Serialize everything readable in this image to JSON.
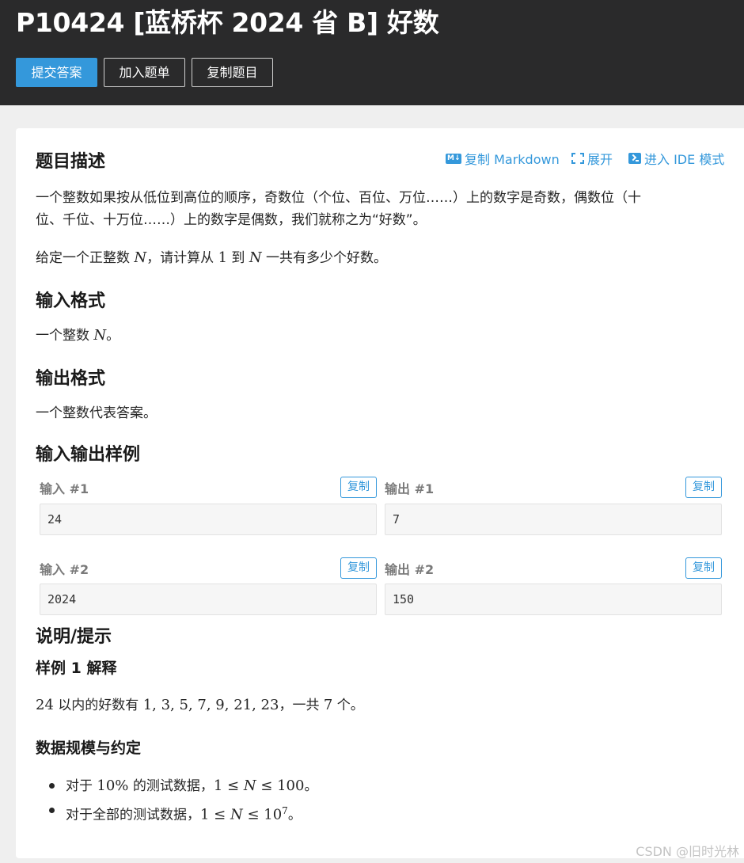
{
  "header": {
    "title": "P10424 [蓝桥杯 2024 省 B] 好数",
    "submit_label": "提交答案",
    "add_list_label": "加入题单",
    "copy_problem_label": "复制题目"
  },
  "actions": {
    "copy_markdown": "复制 Markdown",
    "expand": "展开",
    "enter_ide": "进入 IDE 模式"
  },
  "description": {
    "heading": "题目描述",
    "line1": "一个整数如果按从低位到高位的顺序，奇数位（个位、百位、万位……）上的数字是奇数，偶数位（十",
    "line2": "位、千位、十万位……）上的数字是偶数，我们就称之为“好数”。",
    "given_prefix": "给定一个正整数 ",
    "var_n": "N",
    "given_mid": "，请计算从 ",
    "one": "1",
    "to": " 到 ",
    "given_suffix": " 一共有多少个好数。"
  },
  "input_format": {
    "heading": "输入格式",
    "text_prefix": "一个整数 ",
    "var_n": "N",
    "text_suffix": "。"
  },
  "output_format": {
    "heading": "输出格式",
    "text": "一个整数代表答案。"
  },
  "samples": {
    "heading": "输入输出样例",
    "copy_label": "复制",
    "items": [
      {
        "input_label": "输入 #1",
        "input_value": "24",
        "output_label": "输出 #1",
        "output_value": "7"
      },
      {
        "input_label": "输入 #2",
        "input_value": "2024",
        "output_label": "输出 #2",
        "output_value": "150"
      }
    ]
  },
  "hint": {
    "heading": "说明/提示",
    "sample_heading": "样例 1 解释",
    "explain_num": "24",
    "explain_mid": " 以内的好数有 ",
    "explain_list": "1, 3, 5, 7, 9, 21, 23",
    "explain_tail": "，一共 ",
    "explain_count": "7",
    "explain_end": " 个。",
    "scale_heading": "数据规模与约定",
    "bullet1_prefix": "对于 ",
    "bullet1_pct": "10%",
    "bullet1_mid": " 的测试数据，",
    "bullet1_le1": "1 ≤ ",
    "bullet1_n": "N",
    "bullet1_le2": " ≤ 100",
    "bullet1_end": "。",
    "bullet2_prefix": "对于全部的测试数据，",
    "bullet2_le1": "1 ≤ ",
    "bullet2_n": "N",
    "bullet2_le2": " ≤ 10",
    "bullet2_exp": "7",
    "bullet2_end": "。"
  },
  "watermark": "CSDN @旧时光林",
  "colors": {
    "accent": "#3498db",
    "header_bg": "#2a2a2b",
    "page_bg": "#efefef"
  }
}
